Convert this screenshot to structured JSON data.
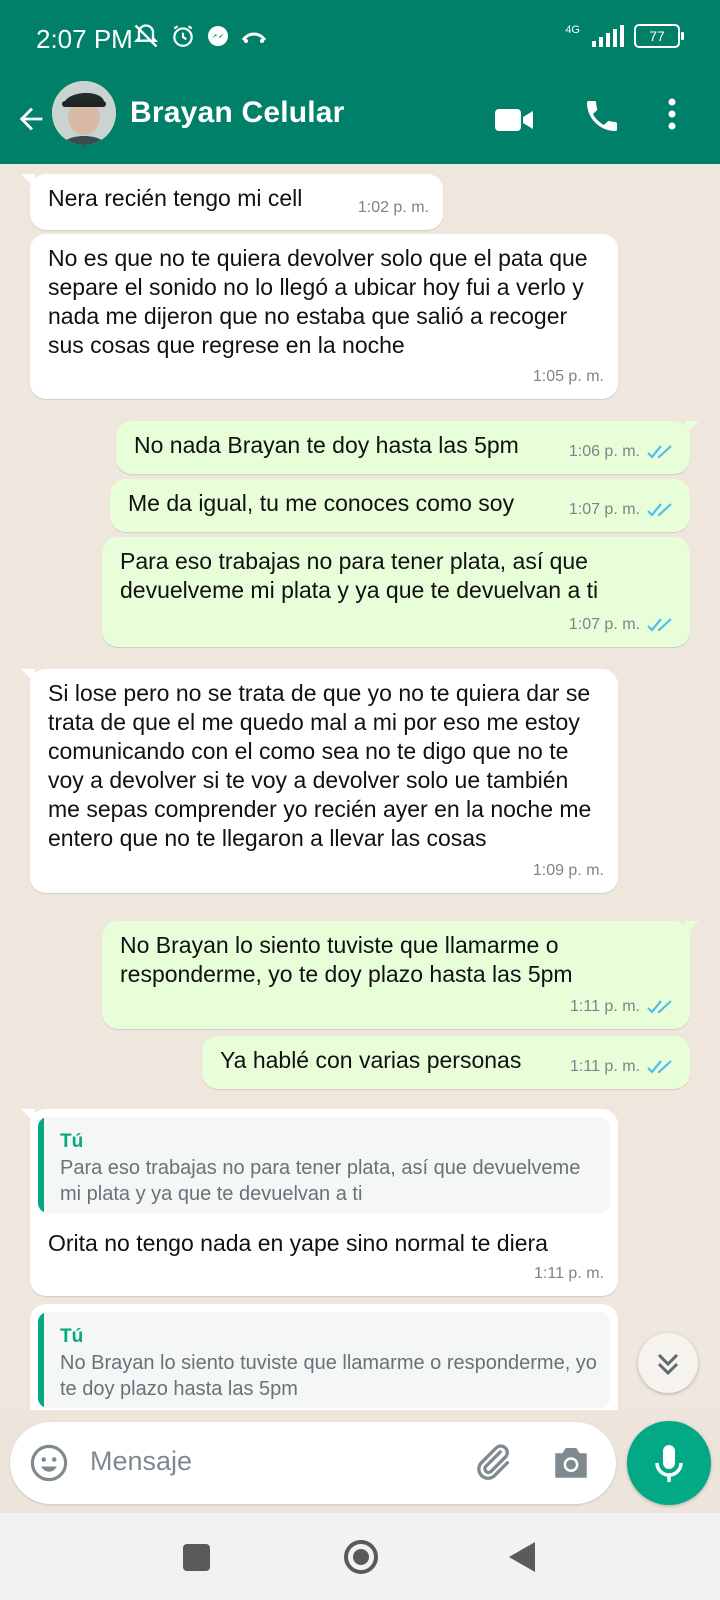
{
  "status_bar": {
    "time": "2:07 PM",
    "network": "4G",
    "battery": "77"
  },
  "header": {
    "contact_name": "Brayan Celular",
    "icons": [
      "back-arrow-icon",
      "video-call-icon",
      "phone-icon",
      "more-vert-icon"
    ]
  },
  "messages": [
    {
      "direction": "in",
      "text": "Nera recién tengo mi cell",
      "time": "1:02 p. m."
    },
    {
      "direction": "in",
      "text": "No es que no te quiera devolver solo que el pata que separe el sonido no lo llegó a ubicar hoy fui a verlo y nada me dijeron que no estaba que salió a recoger sus cosas que regrese en la noche",
      "time": "1:05 p. m."
    },
    {
      "direction": "out",
      "text": "No nada Brayan te doy hasta las 5pm",
      "time": "1:06 p. m.",
      "status": "read"
    },
    {
      "direction": "out",
      "text": "Me da igual, tu me conoces como soy",
      "time": "1:07 p. m.",
      "status": "read"
    },
    {
      "direction": "out",
      "text": "Para eso trabajas no para tener plata, así que devuelveme mi plata y ya que te devuelvan a ti",
      "time": "1:07 p. m.",
      "status": "read"
    },
    {
      "direction": "in",
      "text": "Si lose pero no se trata de que yo no te quiera dar se trata de que el me quedo mal a mi por eso me estoy comunicando con el como sea no te digo que no te voy a devolver si te voy a devolver solo ue también me sepas comprender yo recién  ayer en la noche me entero que no te llegaron a llevar las cosas",
      "time": "1:09 p. m."
    },
    {
      "direction": "out",
      "text": "No Brayan lo siento tuviste que llamarme o responderme, yo te doy plazo hasta las 5pm",
      "time": "1:11 p. m.",
      "status": "read"
    },
    {
      "direction": "out",
      "text": "Ya hablé con varias personas",
      "time": "1:11 p. m.",
      "status": "read"
    },
    {
      "direction": "in",
      "quote_author": "Tú",
      "quote_text": "Para eso trabajas no para tener plata, así que devuelveme mi plata y ya que te devuelvan a ti",
      "text": "Orita no tengo nada en yape sino normal te diera",
      "time": "1:11 p. m."
    },
    {
      "direction": "in",
      "quote_author": "Tú",
      "quote_text": "No Brayan lo siento tuviste que llamarme o responderme, yo te doy plazo hasta las 5pm"
    }
  ],
  "composer": {
    "placeholder": "Mensaje",
    "icons": [
      "emoji-icon",
      "attach-icon",
      "camera-icon",
      "mic-icon"
    ]
  },
  "colors": {
    "header": "#008069",
    "outgoing_bubble": "#e7fed9",
    "incoming_bubble": "#ffffff",
    "accent": "#03a884",
    "read_ticks": "#53bdeb"
  }
}
